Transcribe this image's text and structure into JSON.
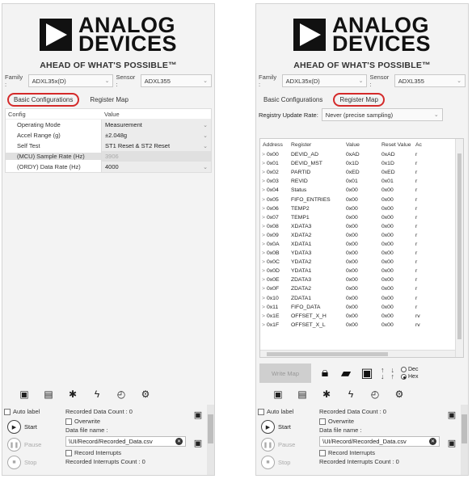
{
  "brand": {
    "line1": "ANALOG",
    "line2": "DEVICES",
    "tagline": "AHEAD OF WHAT'S POSSIBLE™"
  },
  "selectors": {
    "family_label": "Family :",
    "family_value": "ADXL35x(D)",
    "sensor_label": "Sensor :",
    "sensor_value": "ADXL355"
  },
  "tabs": {
    "basic": "Basic Configurations",
    "register": "Register Map"
  },
  "config": {
    "col_config": "Config",
    "col_value": "Value",
    "rows": [
      {
        "key": "Operating Mode",
        "value": "Measurement"
      },
      {
        "key": "Accel Range (g)",
        "value": "±2.048g"
      },
      {
        "key": "Self Test",
        "value": "ST1 Reset & ST2 Reset"
      },
      {
        "key": "(MCU) Sample Rate (Hz)",
        "value": "3906"
      },
      {
        "key": "(ORDY) Data Rate (Hz)",
        "value": "4000"
      }
    ]
  },
  "register_map": {
    "rate_label": "Registry Update Rate:",
    "rate_value": "Never (precise sampling)",
    "col_address": "Address",
    "col_register": "Register",
    "col_value": "Value",
    "col_reset": "Reset Value",
    "col_access": "Ac",
    "rows": [
      {
        "addr": "0x00",
        "name": "DEVID_AD",
        "value": "0xAD",
        "reset": "0xAD",
        "access": "r"
      },
      {
        "addr": "0x01",
        "name": "DEVID_MST",
        "value": "0x1D",
        "reset": "0x1D",
        "access": "r"
      },
      {
        "addr": "0x02",
        "name": "PARTID",
        "value": "0xED",
        "reset": "0xED",
        "access": "r"
      },
      {
        "addr": "0x03",
        "name": "REVID",
        "value": "0x01",
        "reset": "0x01",
        "access": "r"
      },
      {
        "addr": "0x04",
        "name": "Status",
        "value": "0x00",
        "reset": "0x00",
        "access": "r"
      },
      {
        "addr": "0x05",
        "name": "FIFO_ENTRIES",
        "value": "0x00",
        "reset": "0x00",
        "access": "r"
      },
      {
        "addr": "0x06",
        "name": "TEMP2",
        "value": "0x00",
        "reset": "0x00",
        "access": "r"
      },
      {
        "addr": "0x07",
        "name": "TEMP1",
        "value": "0x00",
        "reset": "0x00",
        "access": "r"
      },
      {
        "addr": "0x08",
        "name": "XDATA3",
        "value": "0x00",
        "reset": "0x00",
        "access": "r"
      },
      {
        "addr": "0x09",
        "name": "XDATA2",
        "value": "0x00",
        "reset": "0x00",
        "access": "r"
      },
      {
        "addr": "0x0A",
        "name": "XDATA1",
        "value": "0x00",
        "reset": "0x00",
        "access": "r"
      },
      {
        "addr": "0x0B",
        "name": "YDATA3",
        "value": "0x00",
        "reset": "0x00",
        "access": "r"
      },
      {
        "addr": "0x0C",
        "name": "YDATA2",
        "value": "0x00",
        "reset": "0x00",
        "access": "r"
      },
      {
        "addr": "0x0D",
        "name": "YDATA1",
        "value": "0x00",
        "reset": "0x00",
        "access": "r"
      },
      {
        "addr": "0x0E",
        "name": "ZDATA3",
        "value": "0x00",
        "reset": "0x00",
        "access": "r"
      },
      {
        "addr": "0x0F",
        "name": "ZDATA2",
        "value": "0x00",
        "reset": "0x00",
        "access": "r"
      },
      {
        "addr": "0x10",
        "name": "ZDATA1",
        "value": "0x00",
        "reset": "0x00",
        "access": "r"
      },
      {
        "addr": "0x11",
        "name": "FIFO_DATA",
        "value": "0x00",
        "reset": "0x00",
        "access": "r"
      },
      {
        "addr": "0x1E",
        "name": "OFFSET_X_H",
        "value": "0x00",
        "reset": "0x00",
        "access": "rv"
      },
      {
        "addr": "0x1F",
        "name": "OFFSET_X_L",
        "value": "0x00",
        "reset": "0x00",
        "access": "rv"
      }
    ],
    "write_map": "Write Map",
    "radio_dec": "Dec",
    "radio_hex": "Hex",
    "selected_radix": "Hex"
  },
  "recorder": {
    "auto_label": "Auto label",
    "start": "Start",
    "pause": "Pause",
    "stop": "Stop",
    "count_text": "Recorded Data Count : 0",
    "overwrite": "Overwrite",
    "file_label": "Data file name :",
    "file_value": "\\UI/Record/Recorded_Data.csv",
    "record_interrupts": "Record Interrupts",
    "interrupt_count": "Recorded Interrupts Count : 0"
  },
  "icons": [
    "device-icon",
    "board-icon",
    "bluetooth-icon",
    "plugin-icon",
    "gauge-icon",
    "settings-icon"
  ],
  "accent_color": "#d42a2a"
}
